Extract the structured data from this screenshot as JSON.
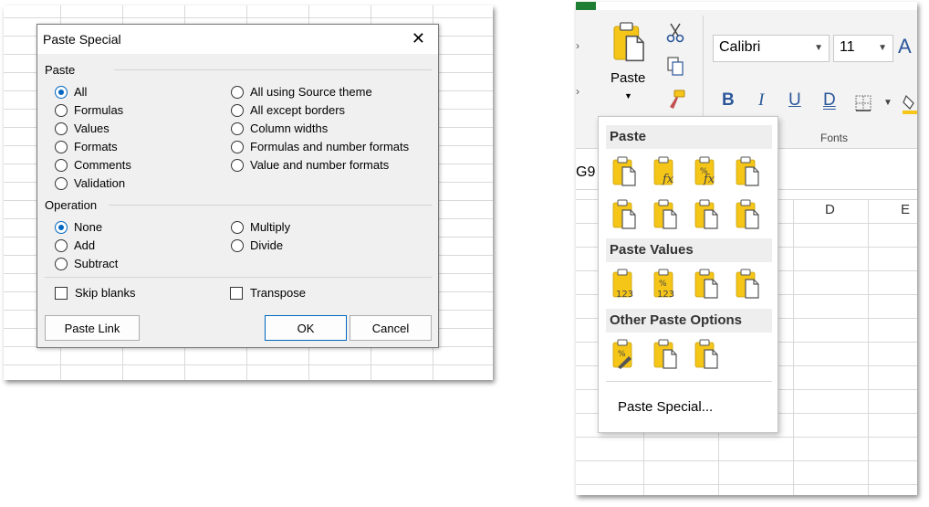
{
  "dialog": {
    "title": "Paste Special",
    "paste_label": "Paste",
    "paste_options_left": [
      "All",
      "Formulas",
      "Values",
      "Formats",
      "Comments",
      "Validation"
    ],
    "paste_options_right": [
      "All using Source theme",
      "All except borders",
      "Column widths",
      "Formulas and number formats",
      "Value and number formats"
    ],
    "operation_label": "Operation",
    "operation_left": [
      "None",
      "Add",
      "Subtract"
    ],
    "operation_right": [
      "Multiply",
      "Divide"
    ],
    "skip_blanks": "Skip blanks",
    "transpose": "Transpose",
    "paste_link": "Paste Link",
    "ok": "OK",
    "cancel": "Cancel"
  },
  "ribbon": {
    "paste_label": "Paste",
    "font_name": "Calibri",
    "font_size": "11",
    "grow_font": "A",
    "bold": "B",
    "italic": "I",
    "underline": "U",
    "double_underline": "D",
    "fonts_group": "Fonts"
  },
  "sheet": {
    "name_box": "G9",
    "columns": [
      "D",
      "E"
    ]
  },
  "paste_menu": {
    "paste_header": "Paste",
    "values_header": "Paste Values",
    "other_header": "Other Paste Options",
    "paste_special": "Paste Special...",
    "fx_label": "fx",
    "num_label": "123",
    "pct_label": "%"
  },
  "colors": {
    "clipboard": "#f5c518",
    "accent_blue": "#0067c0",
    "ribbon_blue": "#2b579a"
  }
}
